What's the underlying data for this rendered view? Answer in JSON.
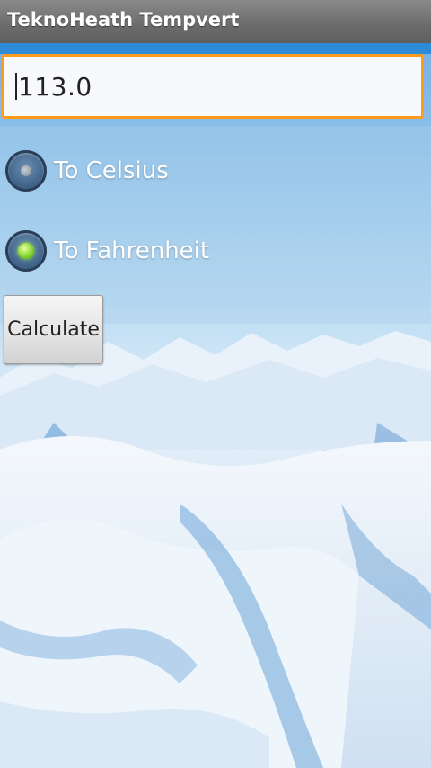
{
  "app": {
    "title": "TeknoHeath Tempvert"
  },
  "input": {
    "value": "113.0"
  },
  "radios": [
    {
      "label": "To Celsius",
      "selected": false
    },
    {
      "label": "To Fahrenheit",
      "selected": true
    }
  ],
  "button": {
    "label": "Calculate"
  },
  "colors": {
    "title_bar": "#6b6b6b",
    "accent_strip": "#2f8ad8",
    "input_focus_border": "#ff9a1a",
    "radio_selected": "#7dd12a"
  }
}
